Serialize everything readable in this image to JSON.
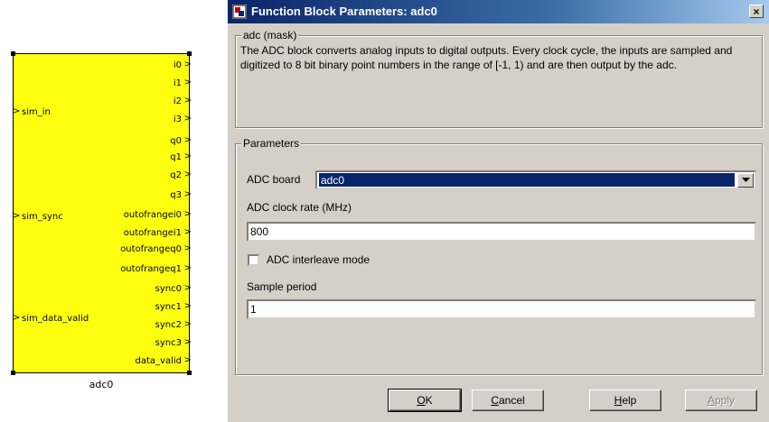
{
  "block": {
    "caption": "adc0",
    "inputs": [
      "sim_in",
      "sim_sync",
      "sim_data_valid"
    ],
    "outputs": [
      "i0",
      "i1",
      "i2",
      "i3",
      "q0",
      "q1",
      "q2",
      "q3",
      "outofrangei0",
      "outofrangei1",
      "outofrangeq0",
      "outofrangeq1",
      "sync0",
      "sync1",
      "sync2",
      "sync3",
      "data_valid"
    ],
    "fill_color": "#ffff10"
  },
  "dialog": {
    "title": "Function Block Parameters: adc0",
    "close_label": "×",
    "mask_group": "adc (mask)",
    "description": "The ADC block converts analog inputs to digital outputs. Every clock cycle, the inputs are sampled and digitized to 8 bit binary point numbers in the range of [-1, 1) and are then output by the adc.",
    "params_group": "Parameters",
    "adc_board": {
      "label": "ADC board",
      "value": "adc0"
    },
    "clock_rate": {
      "label": "ADC clock rate (MHz)",
      "value": "800"
    },
    "interleave": {
      "label": "ADC interleave mode",
      "checked": false
    },
    "sample_period": {
      "label": "Sample period",
      "value": "1"
    },
    "buttons": {
      "ok": {
        "accel": "O",
        "rest": "K"
      },
      "cancel": {
        "accel": "C",
        "rest": "ancel"
      },
      "help": {
        "accel": "H",
        "rest": "elp"
      },
      "apply": {
        "accel": "A",
        "rest": "pply"
      }
    },
    "colors": {
      "title_bar": "#0a246a",
      "face": "#d4d0c8",
      "selection": "#0a246a"
    }
  }
}
